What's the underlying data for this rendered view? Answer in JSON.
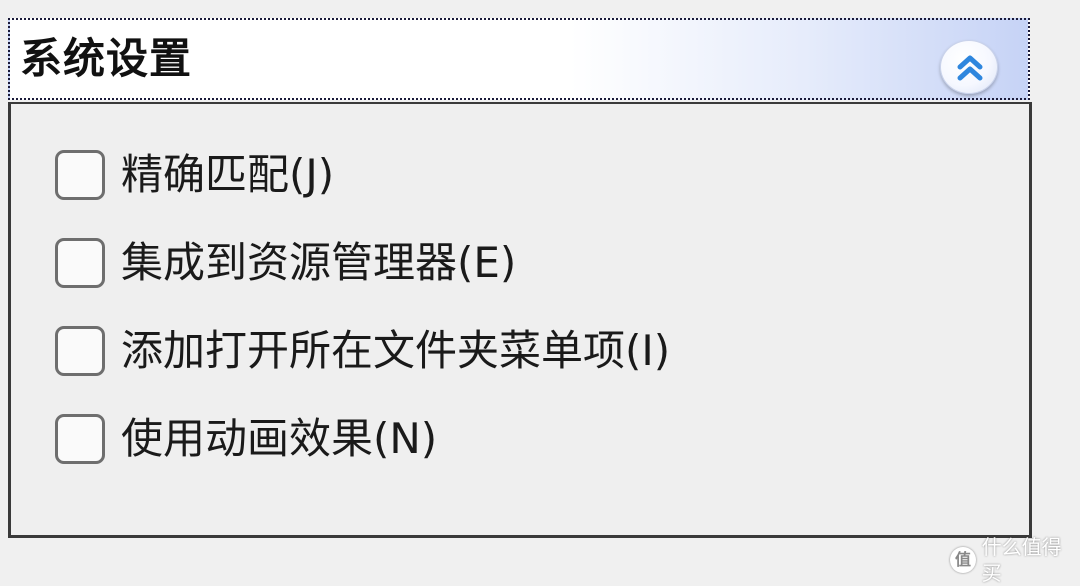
{
  "panel": {
    "title": "系统设置",
    "collapse_icon": "double-chevron-up-icon",
    "options": [
      {
        "label": "精确匹配(J)",
        "checked": false
      },
      {
        "label": "集成到资源管理器(E)",
        "checked": false
      },
      {
        "label": "添加打开所在文件夹菜单项(I)",
        "checked": false
      },
      {
        "label": "使用动画效果(N)",
        "checked": false
      }
    ]
  },
  "watermark": {
    "logo_glyph": "值",
    "text": "什么值得买"
  },
  "colors": {
    "window_background": "#f0f0f0",
    "header_gradient_end": "#c6d3f6",
    "chevron": "#2e86de"
  }
}
